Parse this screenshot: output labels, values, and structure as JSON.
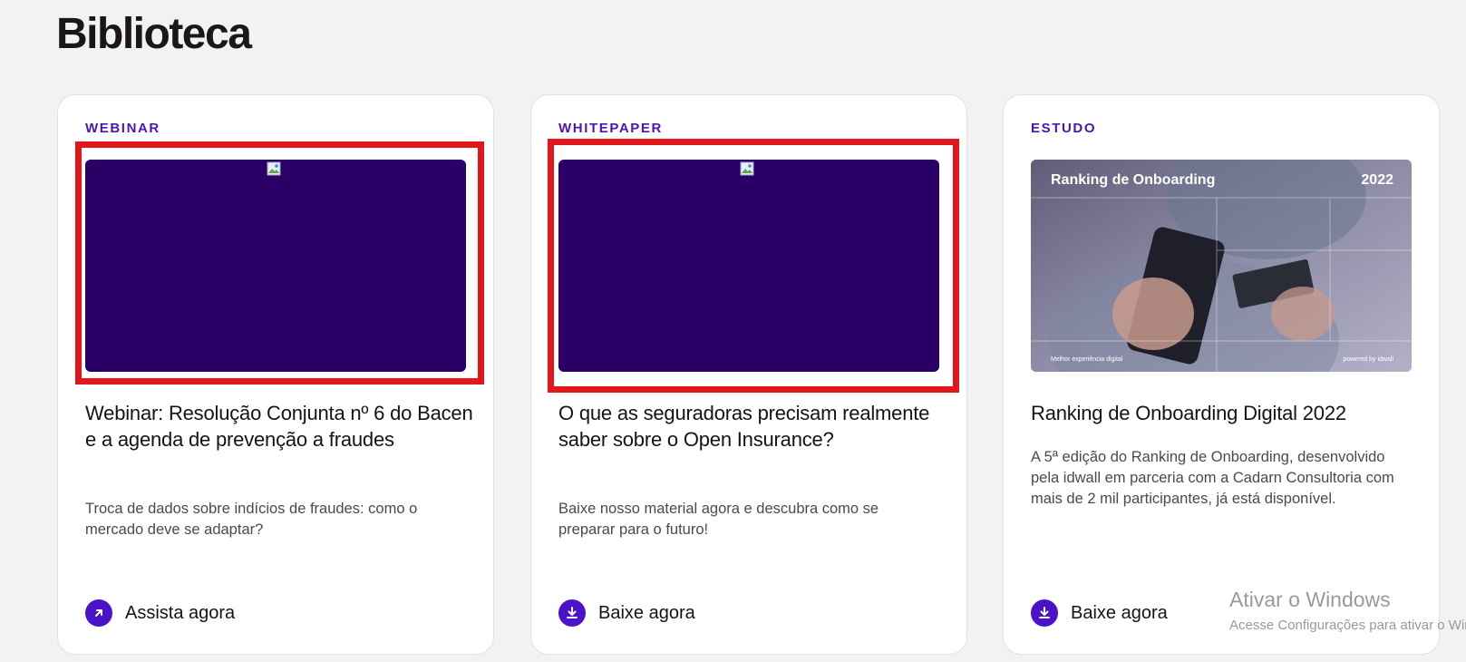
{
  "page": {
    "title": "Biblioteca"
  },
  "cards": [
    {
      "tag": "WEBINAR",
      "title": "Webinar: Resolução Conjunta nº 6 do Bacen e a agenda de prevenção a fraudes",
      "description": "Troca de dados sobre indícios de fraudes: como o mercado deve se adaptar?",
      "cta_label": "Assista agora",
      "cta_icon": "arrow-up-right-icon",
      "thumbnail": "broken-image-icon"
    },
    {
      "tag": "WHITEPAPER",
      "title": "O que as seguradoras precisam realmente saber sobre o Open Insurance?",
      "description": "Baixe nosso material agora e descubra como se preparar para o futuro!",
      "cta_label": "Baixe agora",
      "cta_icon": "download-icon",
      "thumbnail": "broken-image-icon"
    },
    {
      "tag": "ESTUDO",
      "title": "Ranking de Onboarding Digital 2022",
      "description": "A 5ª edição do Ranking de Onboarding, desenvolvido pela idwall em parceria com a Cadarn Consultoria com mais de 2 mil participantes, já está disponível.",
      "cta_label": "Baixe agora",
      "cta_icon": "download-icon",
      "cover": {
        "title": "Ranking de Onboarding",
        "year": "2022",
        "footer_left": "Melhor experiência digital",
        "footer_right": "powered by idwall"
      }
    }
  ],
  "watermark": {
    "title": "Ativar o Windows",
    "subtitle": "Acesse Configurações para ativar o Windows."
  },
  "colors": {
    "accent": "#4a12c9",
    "tag": "#4b14b8",
    "thumb_bg": "#2a0066",
    "highlight": "#e3161b",
    "page_bg": "#f1f2f2"
  }
}
